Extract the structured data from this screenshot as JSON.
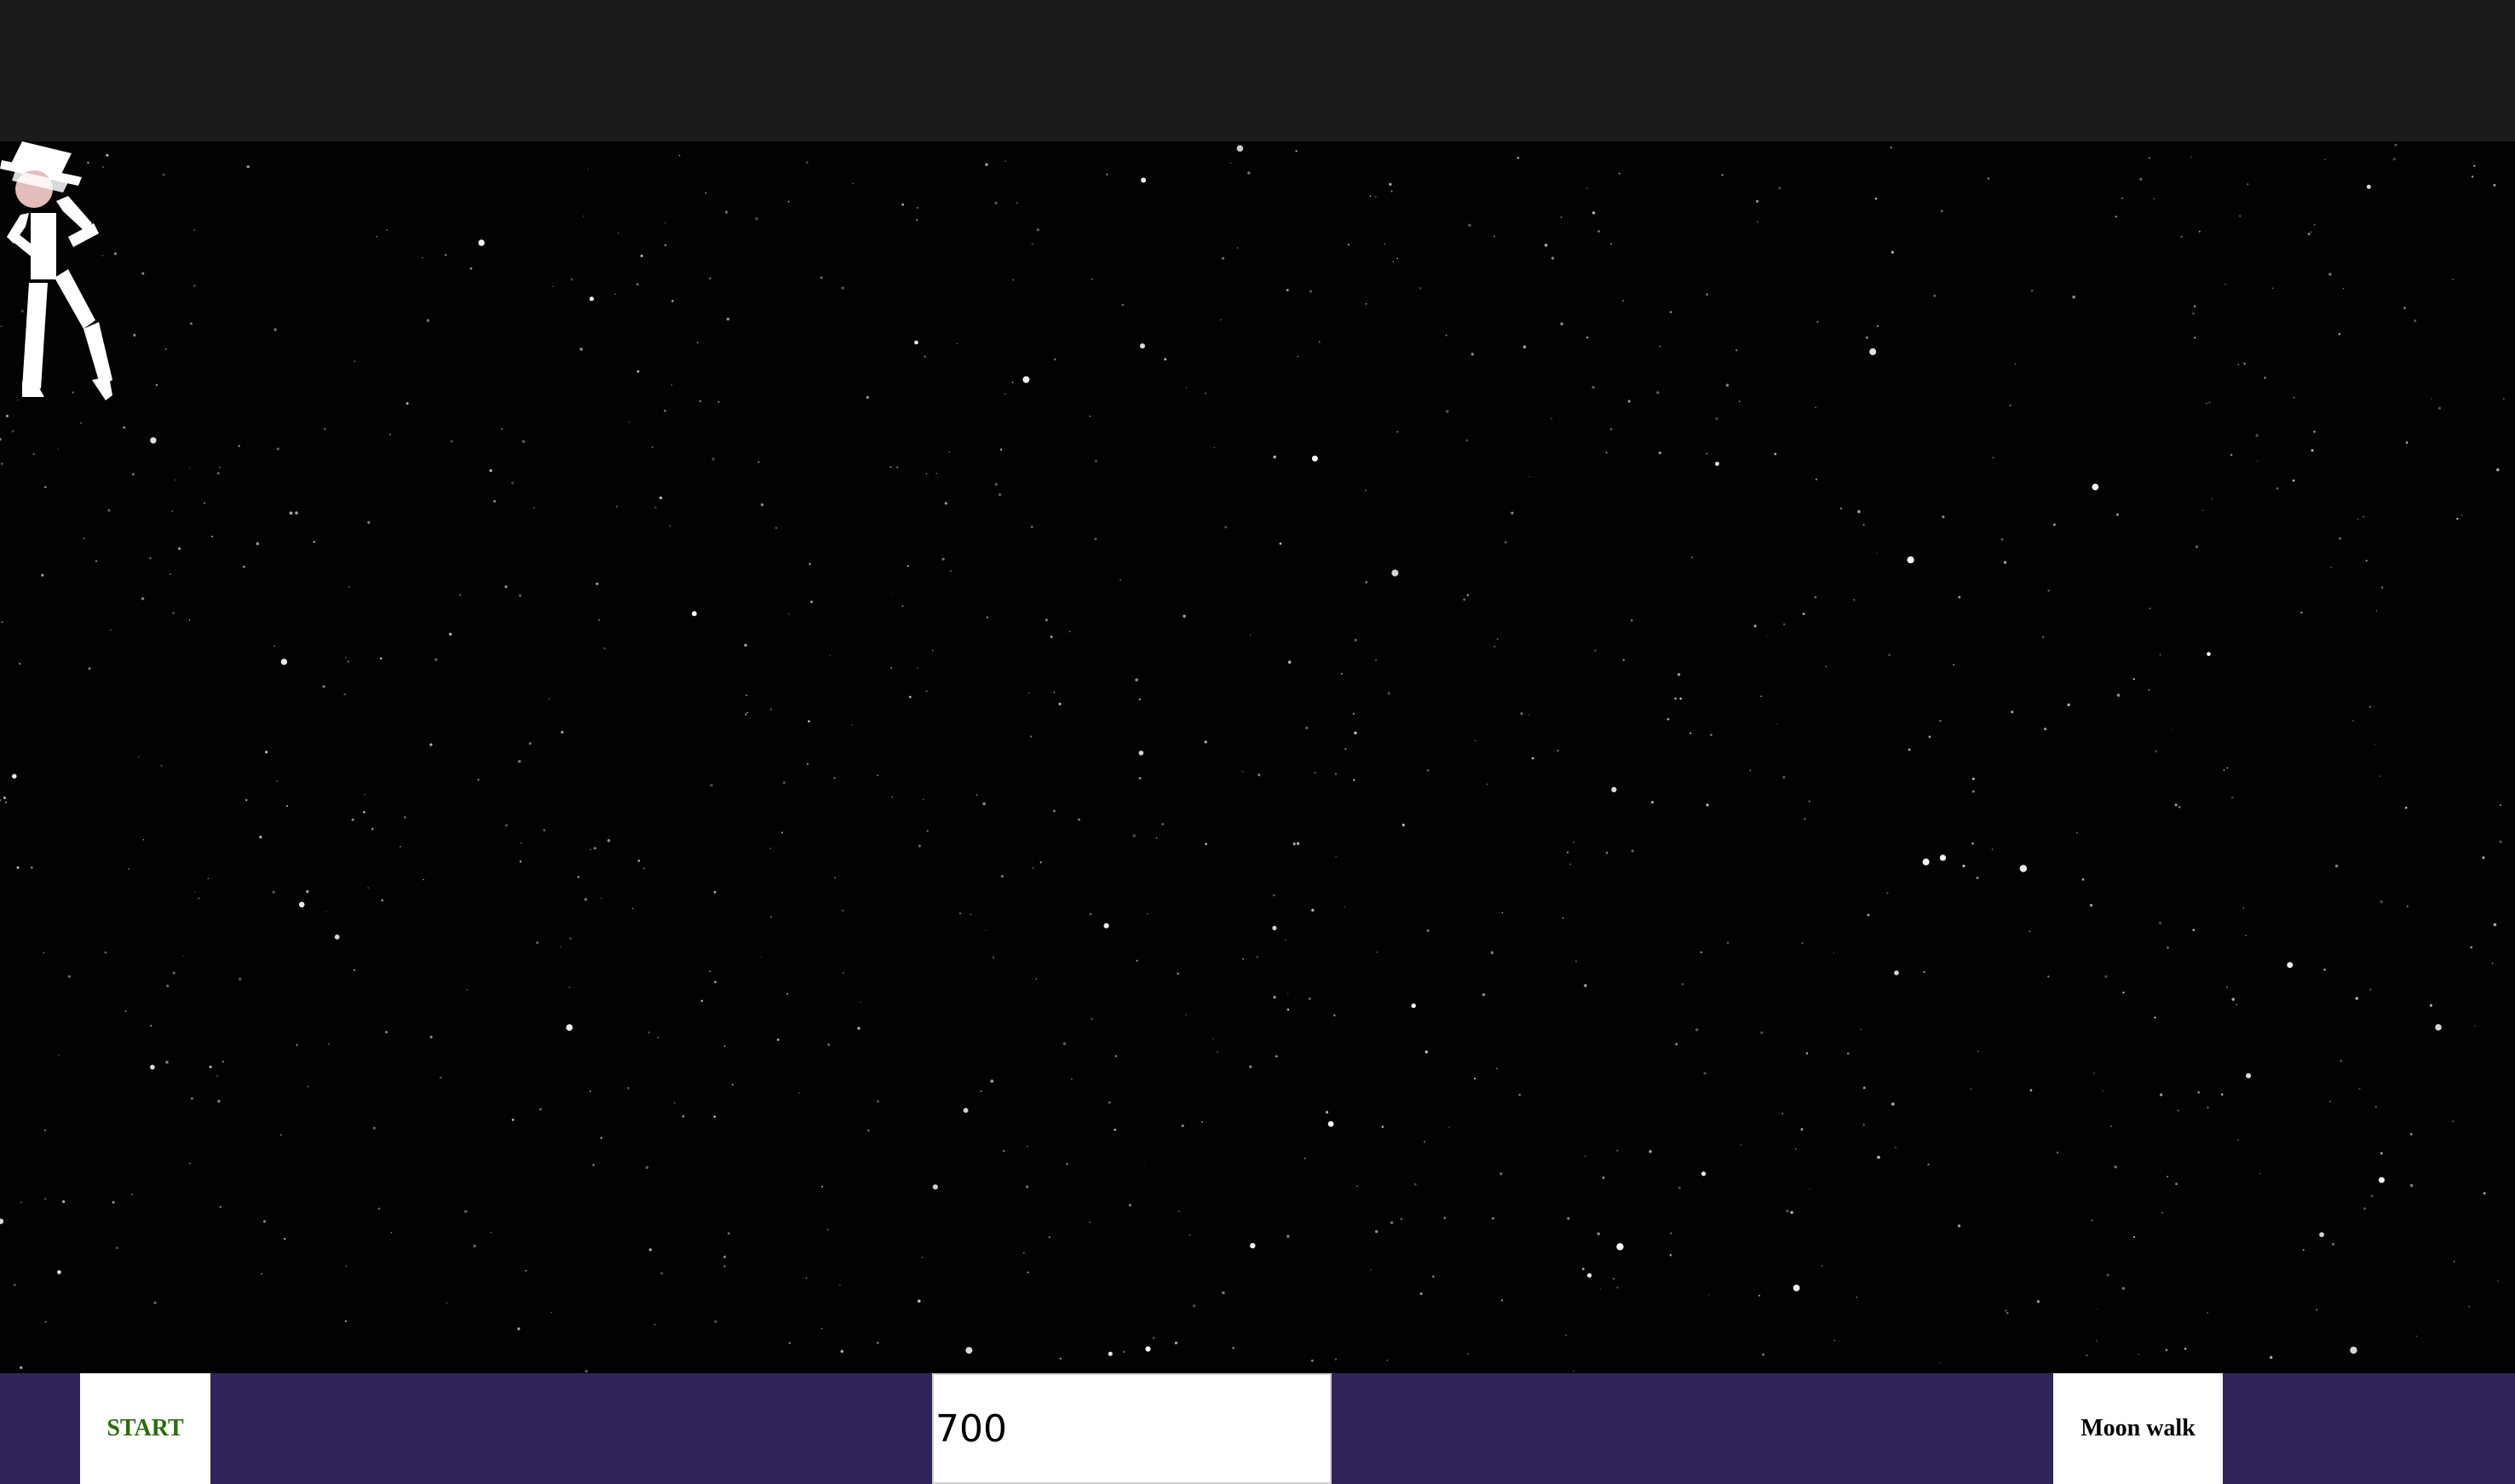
{
  "controls": {
    "start_label": "START",
    "speed_value": "700",
    "moonwalk_label": "Moon walk"
  },
  "colors": {
    "top_bar": "#1b1b1b",
    "stage_background": "#020202",
    "control_bar": "#2f2359",
    "start_text": "#2e6b12",
    "dancer_skin": "#e3bcbc",
    "dancer_suit": "#ffffff"
  },
  "icons": {
    "dancer": "moonwalk-dancer-figure",
    "background": "starfield"
  }
}
